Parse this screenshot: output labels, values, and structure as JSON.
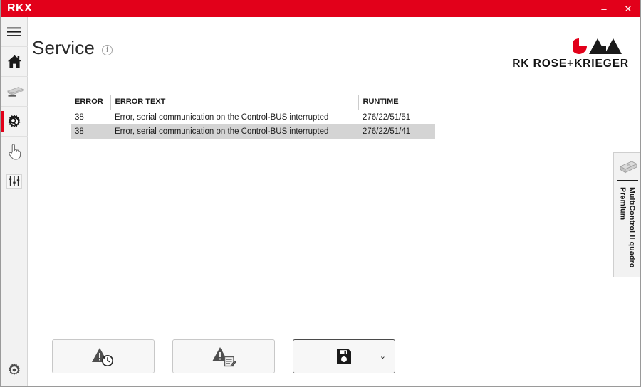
{
  "window": {
    "app_title": "RKX",
    "titlebar_color": "#e2001a",
    "minimize_label": "–",
    "close_label": "✕"
  },
  "sidebar": {
    "items": [
      {
        "id": "menu",
        "icon": "hamburger-menu-icon",
        "label": "Menu",
        "active": false
      },
      {
        "id": "home",
        "icon": "home-icon",
        "label": "Home",
        "active": false
      },
      {
        "id": "desk",
        "icon": "desk-icon",
        "label": "Desk",
        "active": false
      },
      {
        "id": "service",
        "icon": "service-gear-wrench-icon",
        "label": "Service",
        "active": true
      },
      {
        "id": "manual",
        "icon": "hand-pointer-icon",
        "label": "Manual",
        "active": false
      },
      {
        "id": "settings",
        "icon": "sliders-icon",
        "label": "Parameters",
        "active": false
      }
    ],
    "bottom_item": {
      "id": "config",
      "icon": "gear-icon",
      "label": "Configuration"
    },
    "accent_color": "#e2001a"
  },
  "header": {
    "title": "Service",
    "info_icon": "info-circle-icon",
    "info_glyph": "i"
  },
  "brand": {
    "name": "RK ROSE+KRIEGER",
    "mark": "rk-rose-krieger-logo",
    "mark_red": "#e2001a",
    "mark_black": "#1a1a1a"
  },
  "table": {
    "columns": [
      "ERROR",
      "ERROR TEXT",
      "RUNTIME"
    ],
    "rows": [
      {
        "error": "38",
        "text": "Error, serial communication on the Control-BUS interrupted",
        "runtime": "276/22/51/51"
      },
      {
        "error": "38",
        "text": "Error, serial communication on the Control-BUS interrupted",
        "runtime": "276/22/51/41"
      }
    ]
  },
  "device_panel": {
    "icon": "control-unit-icon",
    "label": "MultiControl II quadro Premium"
  },
  "actions": [
    {
      "id": "error-history",
      "icon": "warning-clock-icon",
      "label": "Error history"
    },
    {
      "id": "error-log",
      "icon": "warning-document-icon",
      "label": "Error log"
    },
    {
      "id": "save",
      "icon": "floppy-save-icon",
      "label": "Save",
      "chevron": "⌄",
      "focused": true
    }
  ]
}
